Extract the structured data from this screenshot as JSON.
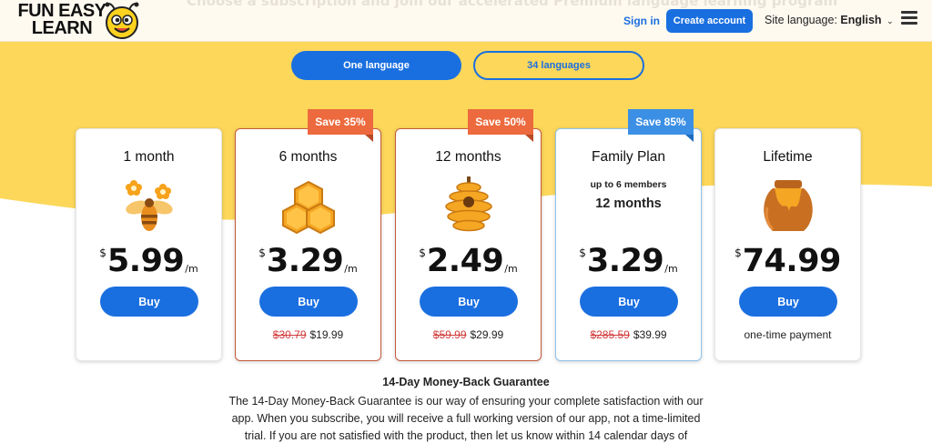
{
  "header": {
    "ghost_title": "Choose a subscription and join our accelerated Premium language learning program",
    "logo_text": "FUN EASY LEARN",
    "sign_in": "Sign in",
    "create_account": "Create account",
    "site_language_label": "Site language:",
    "site_language_value": "English"
  },
  "toggle": {
    "option_one": "One language",
    "option_two": "34 languages"
  },
  "plans": [
    {
      "title": "1 month",
      "currency": "$",
      "price": "5.99",
      "per": "/m",
      "buy": "Buy"
    },
    {
      "title": "6 months",
      "currency": "$",
      "price": "3.29",
      "per": "/m",
      "buy": "Buy",
      "badge": "Save 35%",
      "original": "$30.79",
      "total": "$19.99"
    },
    {
      "title": "12 months",
      "currency": "$",
      "price": "2.49",
      "per": "/m",
      "buy": "Buy",
      "badge": "Save 50%",
      "original": "$59.99",
      "total": "$29.99"
    },
    {
      "title": "Family Plan",
      "subtitle": "up to 6 members",
      "subtitle2": "12 months",
      "currency": "$",
      "price": "3.29",
      "per": "/m",
      "buy": "Buy",
      "badge": "Save 85%",
      "original": "$285.59",
      "total": "$39.99"
    },
    {
      "title": "Lifetime",
      "currency": "$",
      "price": "74.99",
      "per": "",
      "buy": "Buy",
      "note": "one-time payment"
    }
  ],
  "guarantee": {
    "title": "14-Day Money-Back Guarantee",
    "body": "The 14-Day Money-Back Guarantee is our way of ensuring your complete satisfaction with our app. When you subscribe, you will receive a full working version of our app, not a time-limited trial. If you are not satisfied with the product, then let us know within 14 calendar days of"
  },
  "colors": {
    "accent": "#1a6fe0",
    "band": "#fcd75a",
    "badge_orange": "#ec6a3d",
    "badge_blue": "#3b8fe4",
    "strike": "#d23a3a"
  },
  "icons": [
    "bee-mascot-icon",
    "menu-icon",
    "chevron-down-icon",
    "bee-flowers-icon",
    "honeycomb-icon",
    "beehive-icon",
    "honeycomb-family-icon",
    "honey-pot-icon"
  ]
}
